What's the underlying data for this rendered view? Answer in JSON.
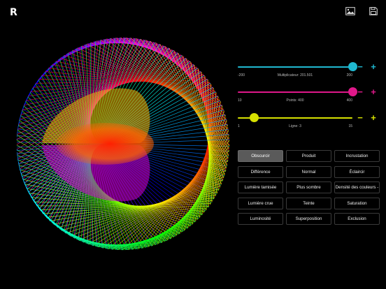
{
  "app": {
    "logo": "R"
  },
  "toolbar": {
    "image_icon": "image-icon",
    "save_icon": "save-icon"
  },
  "colors": {
    "cyan": "#1fb8d0",
    "magenta": "#e0188a",
    "yellow": "#d6e000",
    "active_button": "#5a5a5a"
  },
  "sliders": [
    {
      "id": "multiplier",
      "min_label": "-200",
      "max_label": "200",
      "caption": "Multiplicateur: 201.501",
      "min": -200,
      "max": 200,
      "value": 201.501,
      "color": "#1fb8d0",
      "minus": "−",
      "plus": "+"
    },
    {
      "id": "points",
      "min_label": "10",
      "max_label": "400",
      "caption": "Points: 400",
      "min": 10,
      "max": 400,
      "value": 400,
      "color": "#e0188a",
      "minus": "−",
      "plus": "+"
    },
    {
      "id": "line",
      "min_label": "1",
      "max_label": "15",
      "caption": "Ligne: 3",
      "min": 1,
      "max": 15,
      "value": 3,
      "color": "#d6e000",
      "minus": "−",
      "plus": "+"
    }
  ],
  "blend_modes": [
    [
      "Obscurcir",
      "Produit",
      "Incrustation"
    ],
    [
      "Différence",
      "Normal",
      "Éclaircir"
    ],
    [
      "Lumière tamisée",
      "Plus sombre",
      "Densité des couleurs -"
    ],
    [
      "Lumière crue",
      "Teinte",
      "Saturation"
    ],
    [
      "Luminosité",
      "Superposition",
      "Exclusion"
    ]
  ],
  "selected_blend": "Obscurcir"
}
